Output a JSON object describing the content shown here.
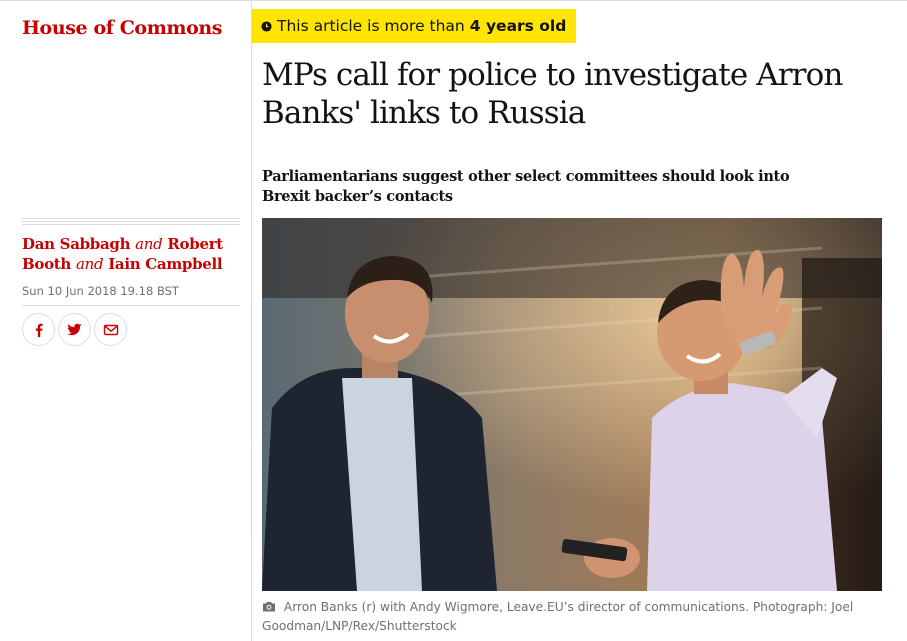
{
  "section": {
    "label": "House of Commons"
  },
  "age_notice": {
    "prefix": "This article is more than",
    "emphasis": "4 years old"
  },
  "headline": "MPs call for police to investigate Arron Banks' links to Russia",
  "standfirst": "Parliamentarians suggest other select committees should look into Brexit backer’s contacts",
  "byline": {
    "author1": "Dan Sabbagh",
    "and1": "and",
    "author2": "Robert Booth",
    "and2": "and",
    "author3": "Iain Campbell"
  },
  "dateline": "Sun 10 Jun 2018 19.18 BST",
  "share": {
    "icons": [
      "facebook-icon",
      "twitter-icon",
      "email-icon"
    ]
  },
  "image": {
    "caption": "Arron Banks (r) with Andy Wigmore, Leave.EU’s director of communications. Photograph: Joel Goodman/LNP/Rex/Shutterstock"
  },
  "colors": {
    "section_red": "#c70000",
    "badge_yellow": "#ffe500",
    "muted_text": "#707070",
    "rule": "#dcdcdc"
  }
}
